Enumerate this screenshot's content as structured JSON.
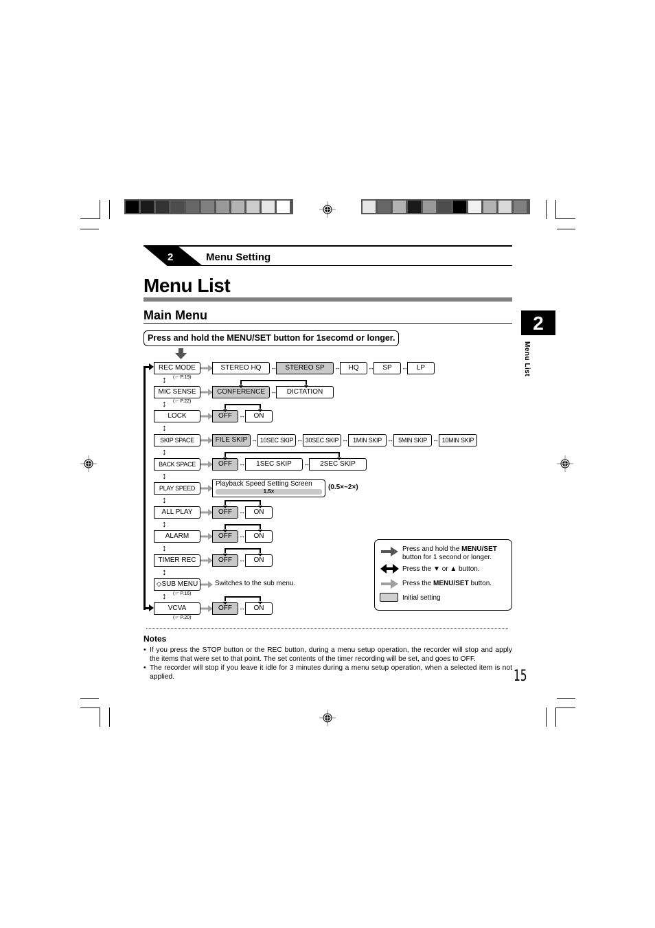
{
  "color_bars": {
    "left": [
      "#000000",
      "#1a1a1a",
      "#333333",
      "#4d4d4d",
      "#666666",
      "#808080",
      "#999999",
      "#b3b3b3",
      "#cccccc",
      "#e6e6e6",
      "#ffffff"
    ],
    "right": [
      "#e6e6e6",
      "#666666",
      "#b3b3b3",
      "#1a1a1a",
      "#999999",
      "#4d4d4d",
      "#000000",
      "#f2f2f2",
      "#b3b3b3",
      "#d9d9d9",
      "#808080"
    ]
  },
  "header": {
    "section_number": "2",
    "section_title": "Menu Setting",
    "page_title": "Menu List",
    "subtitle": "Main Menu",
    "instruction": "Press and hold the MENU/SET button for 1secomd or longer."
  },
  "side_tab": {
    "number": "2",
    "label": "Menu List"
  },
  "menu": {
    "items": [
      {
        "label": "REC MODE",
        "ref": "(☞ P.19)",
        "options": [
          "STEREO HQ",
          "STEREO SP",
          "HQ",
          "SP",
          "LP"
        ],
        "initial": "STEREO SP"
      },
      {
        "label": "MIC SENSE",
        "ref": "(☞ P.22)",
        "options": [
          "CONFERENCE",
          "DICTATION"
        ],
        "initial": "CONFERENCE"
      },
      {
        "label": "LOCK",
        "options": [
          "OFF",
          "ON"
        ],
        "initial": "OFF"
      },
      {
        "label": "SKIP SPACE",
        "options": [
          "FILE SKIP",
          "10SEC SKIP",
          "30SEC SKIP",
          "1MIN SKIP",
          "5MIN SKIP",
          "10MIN SKIP"
        ],
        "initial": "FILE SKIP"
      },
      {
        "label": "BACK SPACE",
        "options": [
          "OFF",
          "1SEC SKIP",
          "2SEC SKIP"
        ],
        "initial": "OFF"
      },
      {
        "label": "PLAY SPEED",
        "screen_title": "Playback Speed Setting Screen",
        "screen_value": "1.5×",
        "range": "(0.5×~2×)"
      },
      {
        "label": "ALL PLAY",
        "options": [
          "OFF",
          "ON"
        ],
        "initial": "OFF"
      },
      {
        "label": "ALARM",
        "options": [
          "OFF",
          "ON"
        ],
        "initial": "OFF"
      },
      {
        "label": "TIMER REC",
        "options": [
          "OFF",
          "ON"
        ],
        "initial": "OFF"
      },
      {
        "label": "◇SUB MENU",
        "ref": "(☞ P.16)",
        "note": "Switches to the sub menu."
      },
      {
        "label": "VCVA",
        "ref": "(☞ P.20)",
        "options": [
          "OFF",
          "ON"
        ],
        "initial": "OFF"
      }
    ]
  },
  "legend": {
    "hold": {
      "pre": "Press and hold the ",
      "bold": "MENU/SET",
      "post": "button for 1 second or longer."
    },
    "updown": "Press the ▼ or ▲ button.",
    "press": {
      "pre": "Press the ",
      "bold": "MENU/SET",
      "post": " button."
    },
    "initial": "Initial setting"
  },
  "notes": {
    "heading": "Notes",
    "items": [
      "If you press the STOP button or the REC button, during a menu setup operation, the recorder will stop and apply the items that were set to that point. The set contents of the timer recording will be set, and goes to OFF.",
      "The recorder will stop if you leave it idle for 3 minutes during a menu setup operation, when a selected item is not applied."
    ]
  },
  "page_number": "15"
}
